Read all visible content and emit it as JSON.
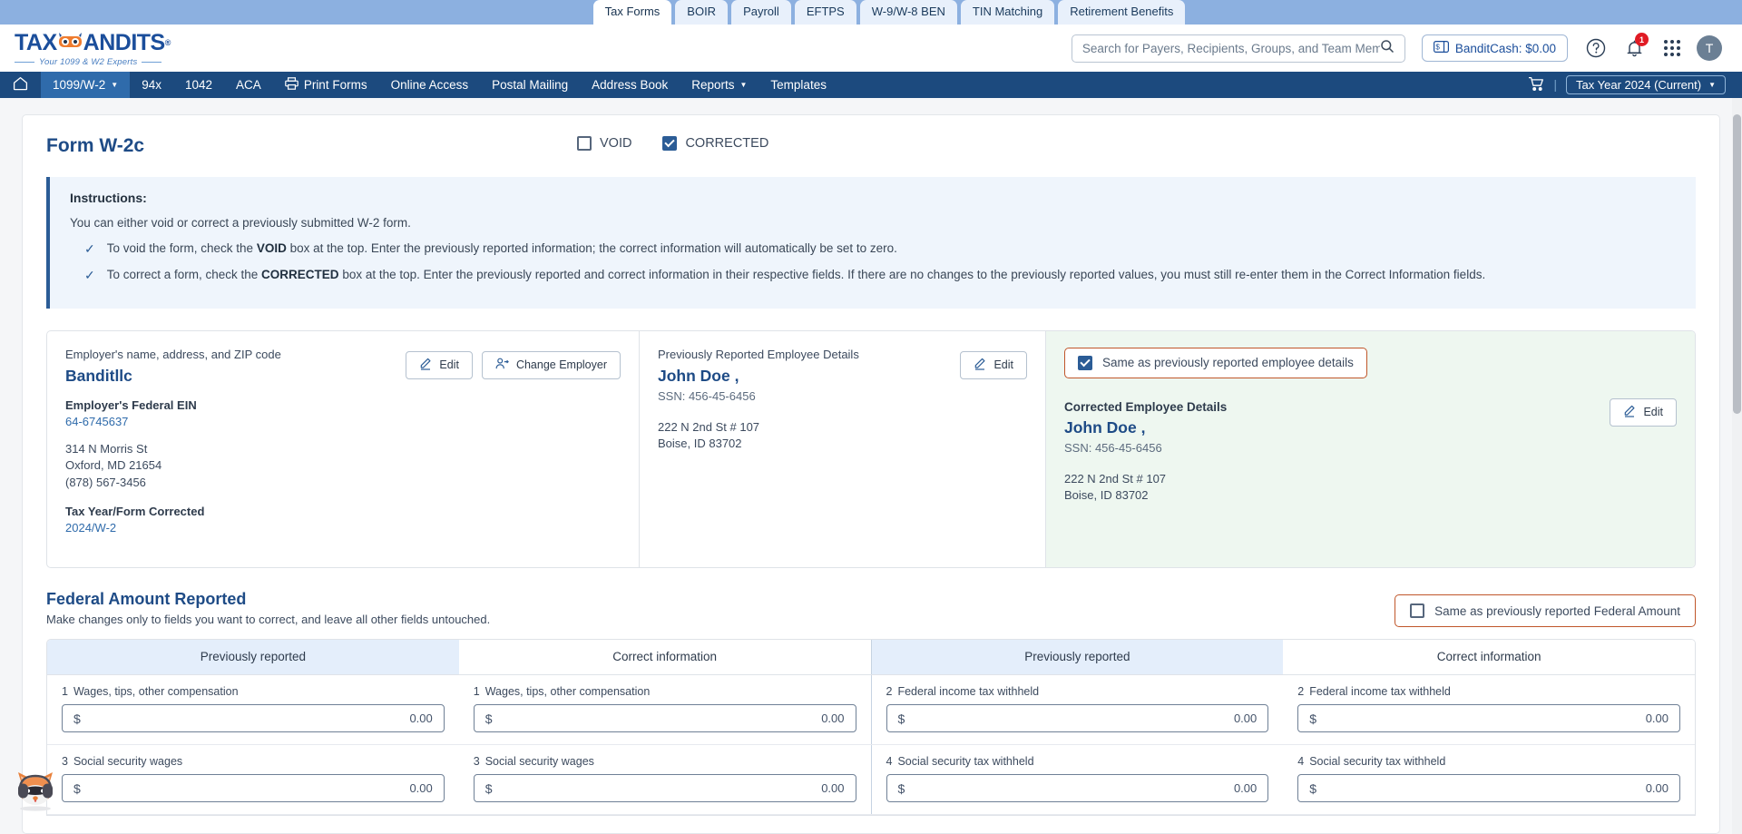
{
  "top_tabs": [
    {
      "label": "Tax Forms",
      "active": true
    },
    {
      "label": "BOIR",
      "active": false
    },
    {
      "label": "Payroll",
      "active": false
    },
    {
      "label": "EFTPS",
      "active": false
    },
    {
      "label": "W-9/W-8 BEN",
      "active": false
    },
    {
      "label": "TIN Matching",
      "active": false
    },
    {
      "label": "Retirement Benefits",
      "active": false
    }
  ],
  "header": {
    "logo_text_1": "TAX",
    "logo_text_2": "ANDITS",
    "logo_reg": "®",
    "logo_tagline": "Your 1099 & W2 Experts",
    "search_placeholder": "Search for Payers, Recipients, Groups, and Team Members",
    "search_value": "",
    "bandit_cash": "BanditCash: $0.00",
    "notification_count": "1",
    "avatar_initial": "T"
  },
  "nav": {
    "items": [
      {
        "label": "1099/W-2",
        "caret": true,
        "active": true
      },
      {
        "label": "94x",
        "caret": false,
        "active": false
      },
      {
        "label": "1042",
        "caret": false,
        "active": false
      },
      {
        "label": "ACA",
        "caret": false,
        "active": false
      },
      {
        "label": "Print Forms",
        "caret": false,
        "active": false,
        "icon": "printer-icon"
      },
      {
        "label": "Online Access",
        "caret": false,
        "active": false
      },
      {
        "label": "Postal Mailing",
        "caret": false,
        "active": false
      },
      {
        "label": "Address Book",
        "caret": false,
        "active": false
      },
      {
        "label": "Reports",
        "caret": true,
        "active": false
      },
      {
        "label": "Templates",
        "caret": false,
        "active": false
      }
    ],
    "divider": "|",
    "tax_year": "Tax Year 2024 (Current)"
  },
  "form": {
    "title": "Form W-2c",
    "void_label": "VOID",
    "void_checked": false,
    "corrected_label": "CORRECTED",
    "corrected_checked": true
  },
  "instructions": {
    "title": "Instructions:",
    "lead": "You can either void or correct a previously submitted W-2 form.",
    "items": [
      {
        "pre": "To void the form, check the ",
        "bold": "VOID",
        "post": " box at the top. Enter the previously reported information; the correct information will automatically be set to zero."
      },
      {
        "pre": "To correct a form, check the ",
        "bold": "CORRECTED",
        "post": " box at the top. Enter the previously reported and correct information in their respective fields. If there are no changes to the previously reported values, you must still re-enter them in the Correct Information fields."
      }
    ]
  },
  "employer": {
    "label": "Employer's name, address, and ZIP code",
    "name": "Banditllc",
    "ein_label": "Employer's Federal EIN",
    "ein": "64-6745637",
    "address_line1": "314 N Morris St",
    "address_line2": "Oxford, MD 21654",
    "phone": "(878) 567-3456",
    "taxyear_label": "Tax Year/Form Corrected",
    "taxyear_value": "2024/W-2",
    "edit_label": "Edit",
    "change_employer_label": "Change Employer"
  },
  "prev_employee": {
    "label": "Previously Reported Employee Details",
    "name": "John Doe ,",
    "ssn": "SSN: 456-45-6456",
    "address_line1": "222 N 2nd St # 107",
    "address_line2": "Boise, ID 83702",
    "edit_label": "Edit"
  },
  "corrected_employee": {
    "same_as_label": "Same as previously reported employee details",
    "same_as_checked": true,
    "label": "Corrected Employee Details",
    "name": "John Doe ,",
    "ssn": "SSN: 456-45-6456",
    "address_line1": "222 N 2nd St # 107",
    "address_line2": "Boise, ID 83702",
    "edit_label": "Edit"
  },
  "federal": {
    "title": "Federal Amount Reported",
    "subtitle": "Make changes only to fields you want to correct, and leave all other fields untouched.",
    "same_as_label": "Same as previously reported Federal Amount",
    "same_as_checked": false,
    "col_prev": "Previously reported",
    "col_corr": "Correct information",
    "rows": [
      {
        "left": {
          "num": "1",
          "label": "Wages, tips, other compensation",
          "prev": "0.00",
          "corr": "0.00"
        },
        "right": {
          "num": "2",
          "label": "Federal income tax withheld",
          "prev": "0.00",
          "corr": "0.00"
        }
      },
      {
        "left": {
          "num": "3",
          "label": "Social security wages",
          "prev": "0.00",
          "corr": "0.00"
        },
        "right": {
          "num": "4",
          "label": "Social security tax withheld",
          "prev": "0.00",
          "corr": "0.00"
        }
      }
    ],
    "currency_symbol": "$"
  },
  "colors": {
    "brand_blue": "#1e4b86",
    "nav_blue": "#1c4a7e",
    "tab_strip": "#8cb0e0",
    "accent_orange": "#c0562a",
    "green_panel": "#eef7f0",
    "badge_red": "#e01b24"
  }
}
